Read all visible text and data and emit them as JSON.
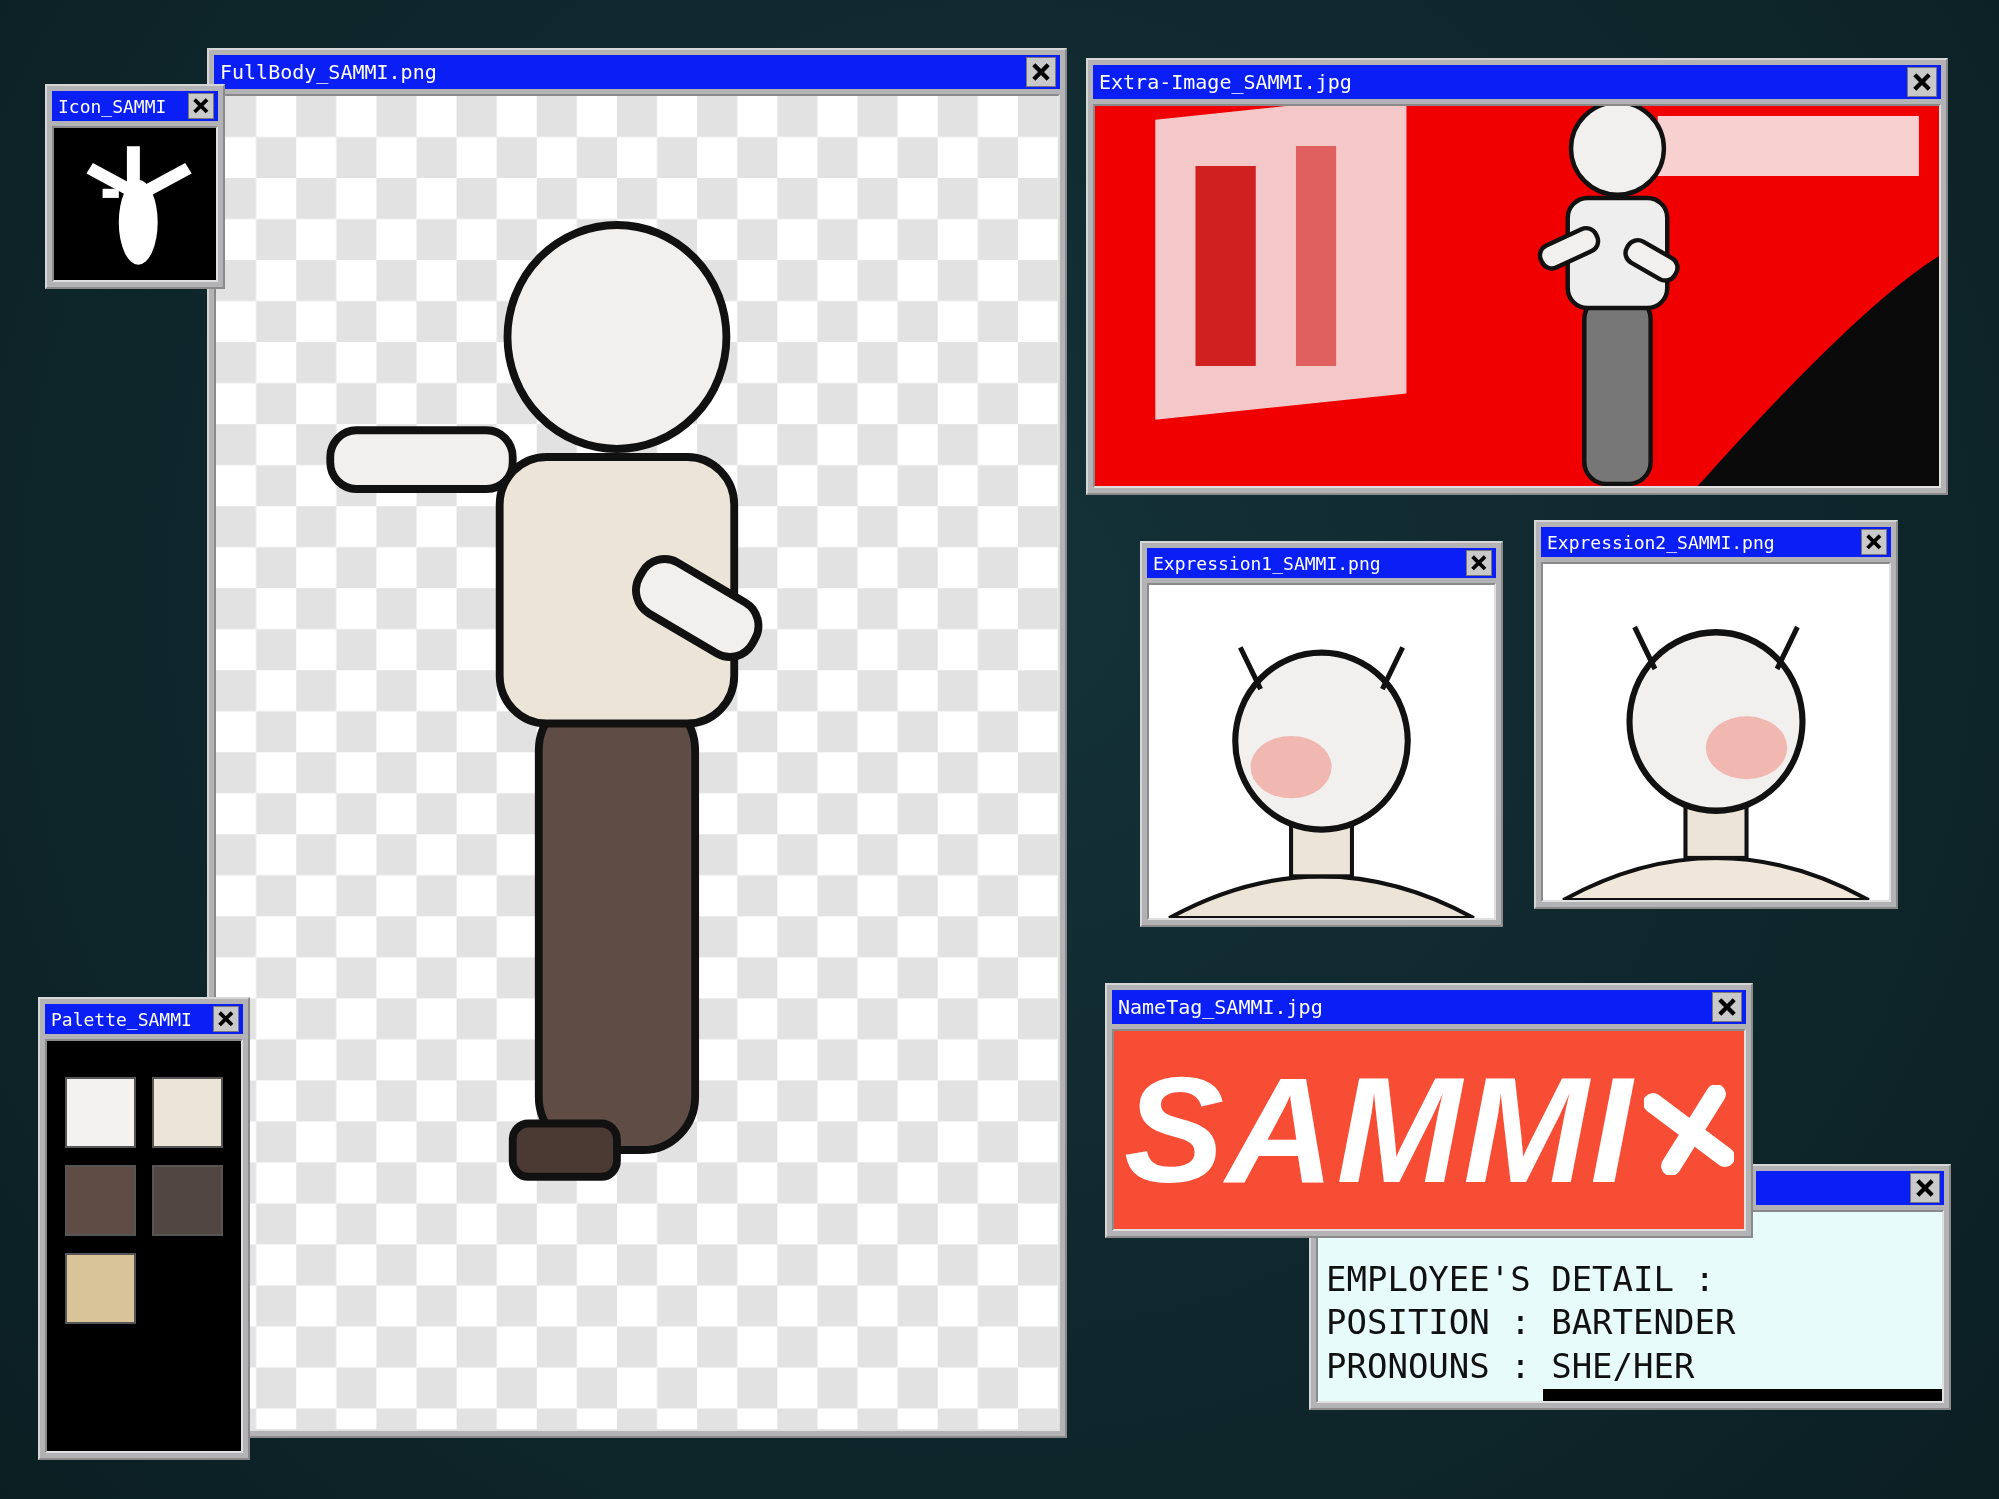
{
  "windows": [
    {
      "kind": "fullbody",
      "title": "FullBody_SAMMI.png"
    },
    {
      "kind": "icon",
      "title": "Icon_SAMMI"
    },
    {
      "kind": "palette",
      "title": "Palette_SAMMI",
      "swatches": [
        {
          "color": "#f3f2f0"
        },
        {
          "color": "#ede4d8"
        },
        {
          "color": "#5f4d45"
        },
        {
          "color": "#524642"
        },
        {
          "color": "#d9c49a"
        }
      ]
    },
    {
      "kind": "extra",
      "title": "Extra-Image_SAMMI.jpg"
    },
    {
      "kind": "expression",
      "title": "Expression1_SAMMI.png"
    },
    {
      "kind": "expression",
      "title": "Expression2_SAMMI.png"
    },
    {
      "kind": "details",
      "lines": [
        "EMPLOYEE'S DETAIL :",
        "POSITION : BARTENDER",
        "PRONOUNS : SHE/HER"
      ]
    },
    {
      "kind": "nametag",
      "title": "NameTag_SAMMI.jpg",
      "name": "SAMMI"
    }
  ]
}
